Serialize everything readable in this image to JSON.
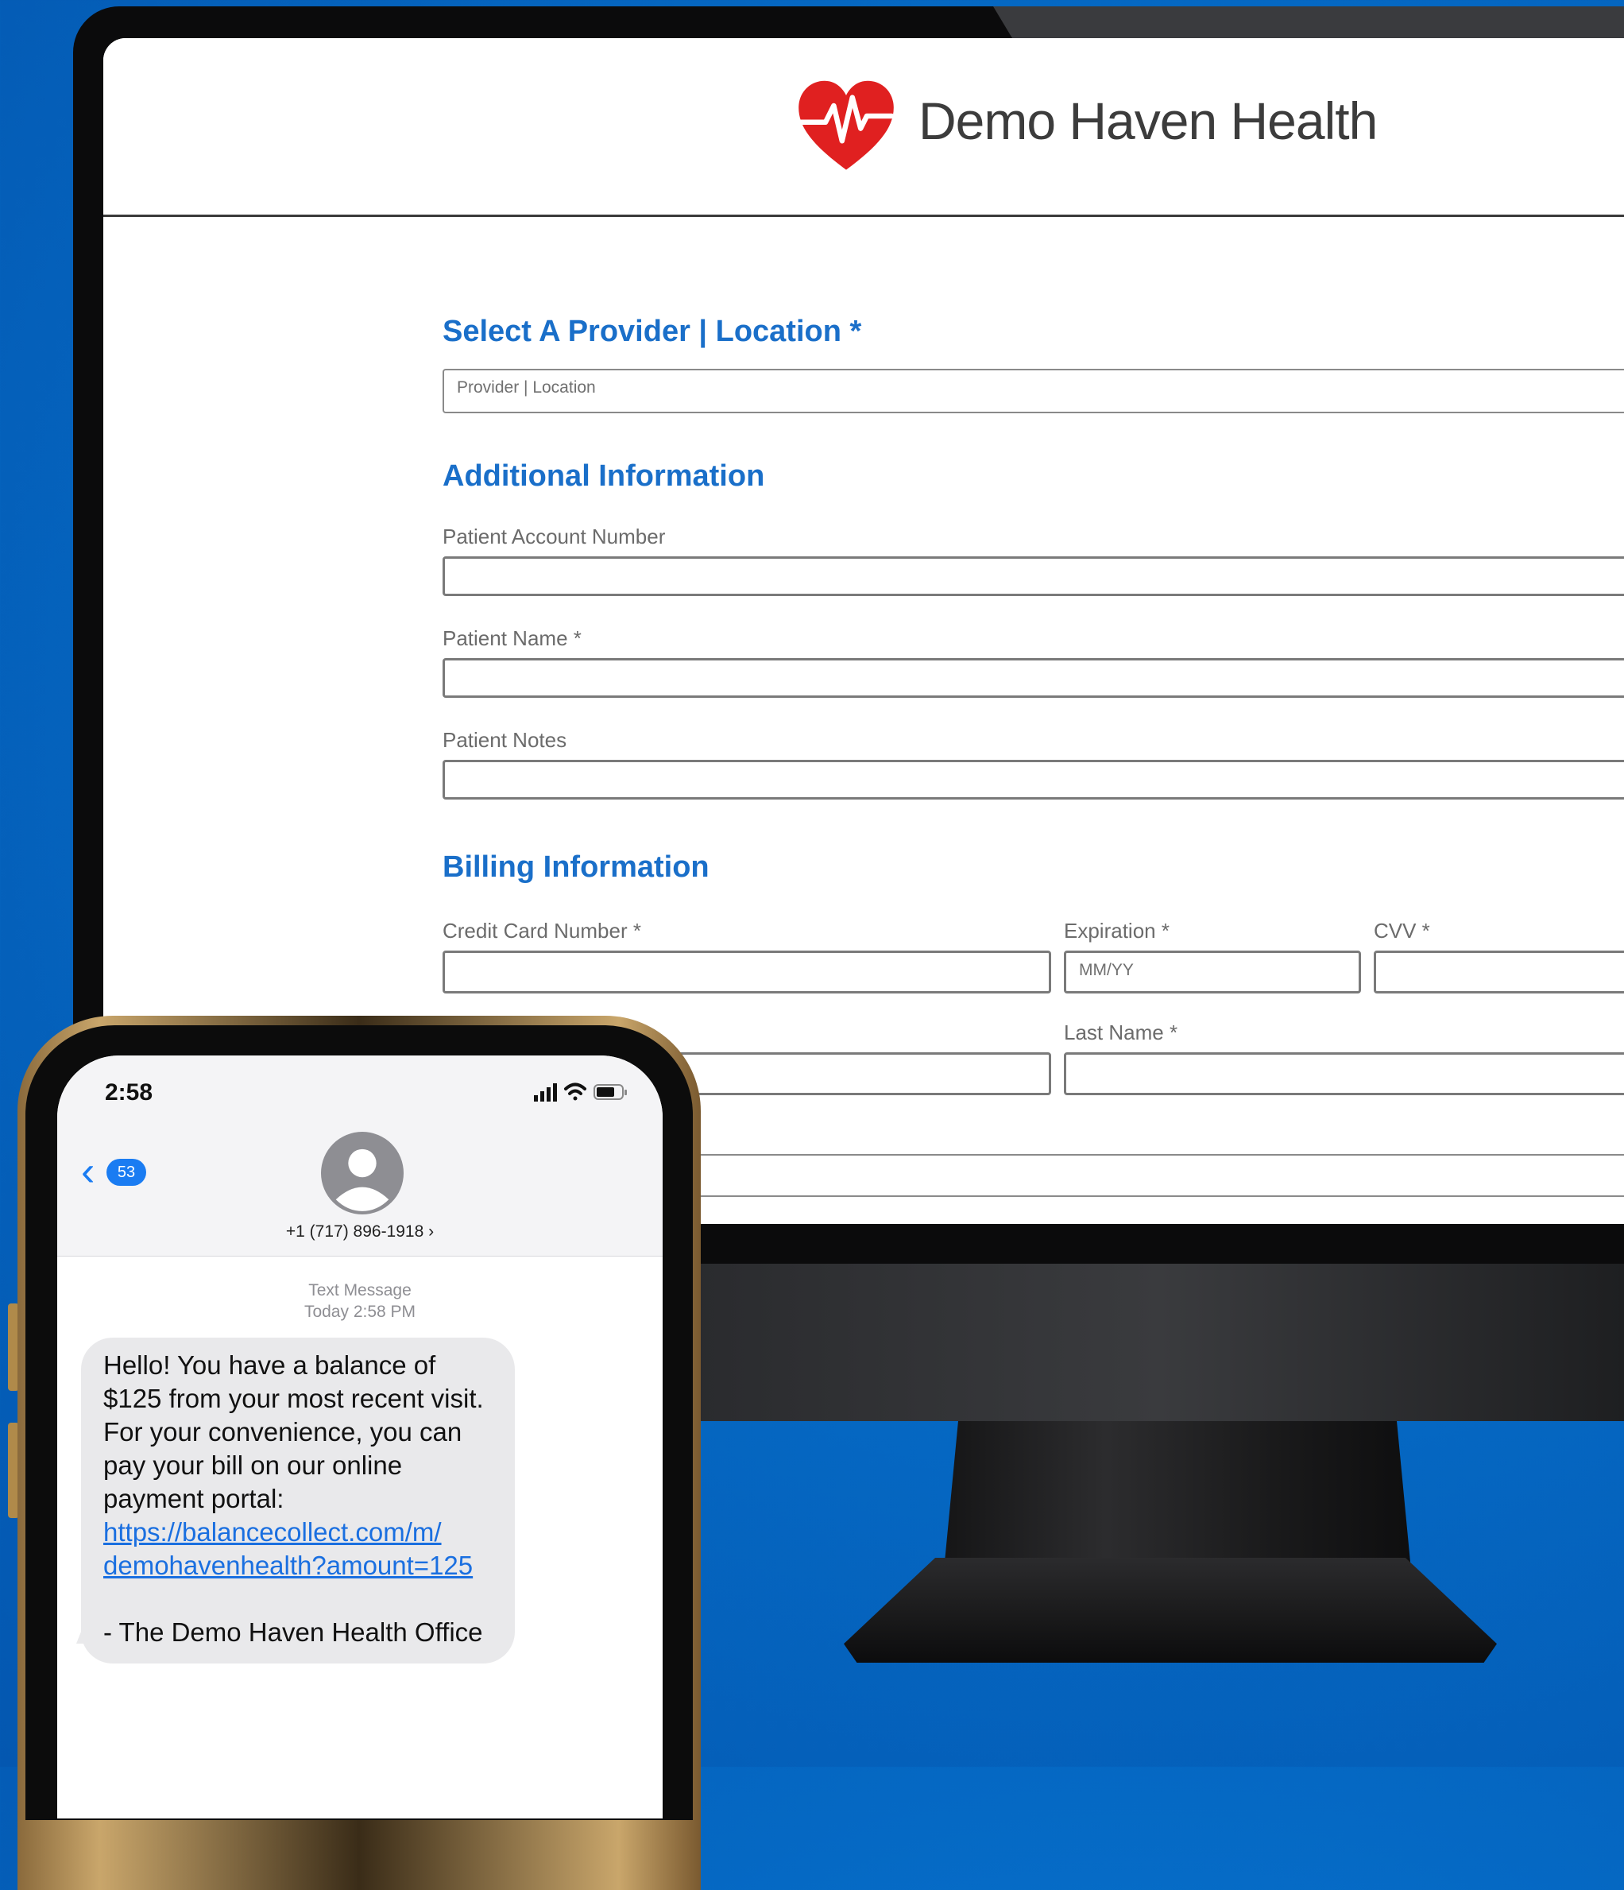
{
  "desktop": {
    "brand": {
      "name": "Demo Haven Health",
      "logo": "heart-pulse-icon",
      "logo_color": "#e02020"
    },
    "provider_section": {
      "heading": "Select A Provider | Location *",
      "placeholder": "Provider | Location"
    },
    "additional_section": {
      "heading": "Additional Information",
      "fields": [
        {
          "label": "Patient Account Number",
          "value": ""
        },
        {
          "label": "Patient Name *",
          "value": ""
        },
        {
          "label": "Patient Notes",
          "value": ""
        }
      ]
    },
    "billing_section": {
      "heading": "Billing Information",
      "card_number_label": "Credit Card Number *",
      "expiration_label": "Expiration *",
      "expiration_placeholder": "MM/YY",
      "cvv_label": "CVV *",
      "last_name_label": "Last Name *"
    },
    "accent_color": "#1a6fc9"
  },
  "phone": {
    "status_time": "2:58",
    "unread_count": "53",
    "contact_number": "+1 (717) 896-1918 ›",
    "message_type": "Text Message",
    "message_time": "Today 2:58 PM",
    "message_body": "Hello! You have a balance of $125 from your most recent visit. For your convenience, you can pay your bill on our online payment portal:",
    "message_link_line1": "https://balancecollect.com/m/",
    "message_link_line2": "demohavenhealth?amount=125",
    "message_signature": "- The Demo Haven Health Office",
    "link_color": "#1a6fe0"
  }
}
